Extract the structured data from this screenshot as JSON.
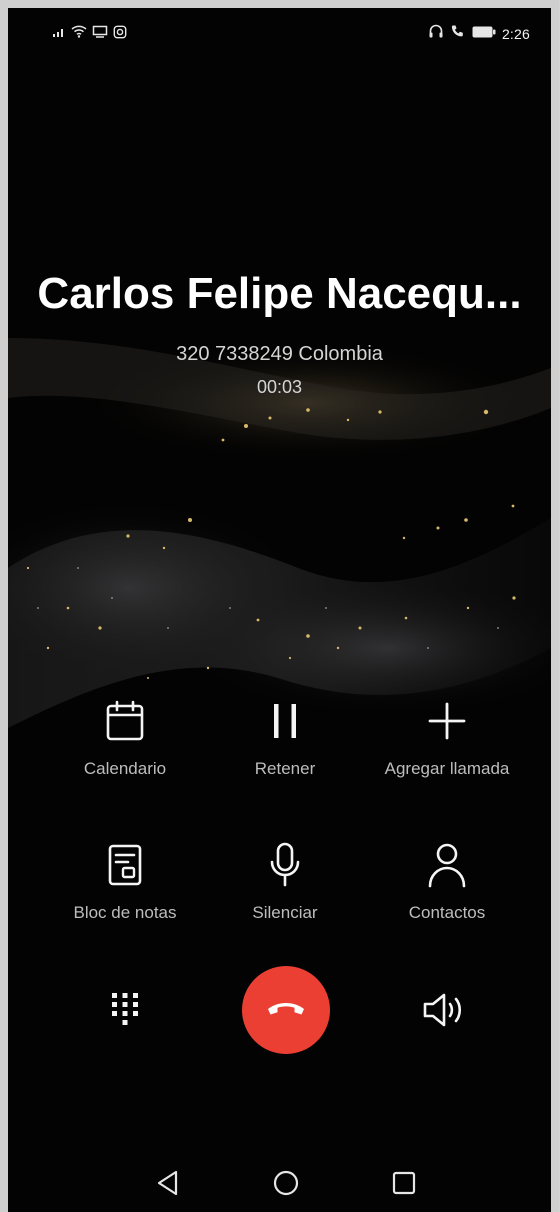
{
  "status_bar": {
    "time": "2:26",
    "left_icons": [
      "signal-icon",
      "wifi-icon",
      "cast-icon",
      "instagram-icon"
    ],
    "right_icons": [
      "headset-icon",
      "call-active-icon",
      "battery-icon"
    ]
  },
  "caller": {
    "name": "Carlos Felipe Nacequ...",
    "number": "320 7338249 Colombia",
    "timer": "00:03"
  },
  "actions": {
    "calendar": {
      "label": "Calendario",
      "icon": "calendar-icon"
    },
    "hold": {
      "label": "Retener",
      "icon": "pause-icon"
    },
    "add_call": {
      "label": "Agregar llamada",
      "icon": "plus-icon"
    },
    "notepad": {
      "label": "Bloc de notas",
      "icon": "notepad-icon"
    },
    "mute": {
      "label": "Silenciar",
      "icon": "microphone-icon"
    },
    "contacts": {
      "label": "Contactos",
      "icon": "person-icon"
    }
  },
  "controls": {
    "dialpad_icon": "dialpad-icon",
    "end_call_icon": "hang-up-icon",
    "speaker_icon": "speaker-icon"
  },
  "navigation": [
    "back-icon",
    "home-icon",
    "recents-icon"
  ],
  "colors": {
    "background": "#030303",
    "end_call": "#ec3f33",
    "label": "#bdbdbd",
    "name": "#ffffff"
  }
}
